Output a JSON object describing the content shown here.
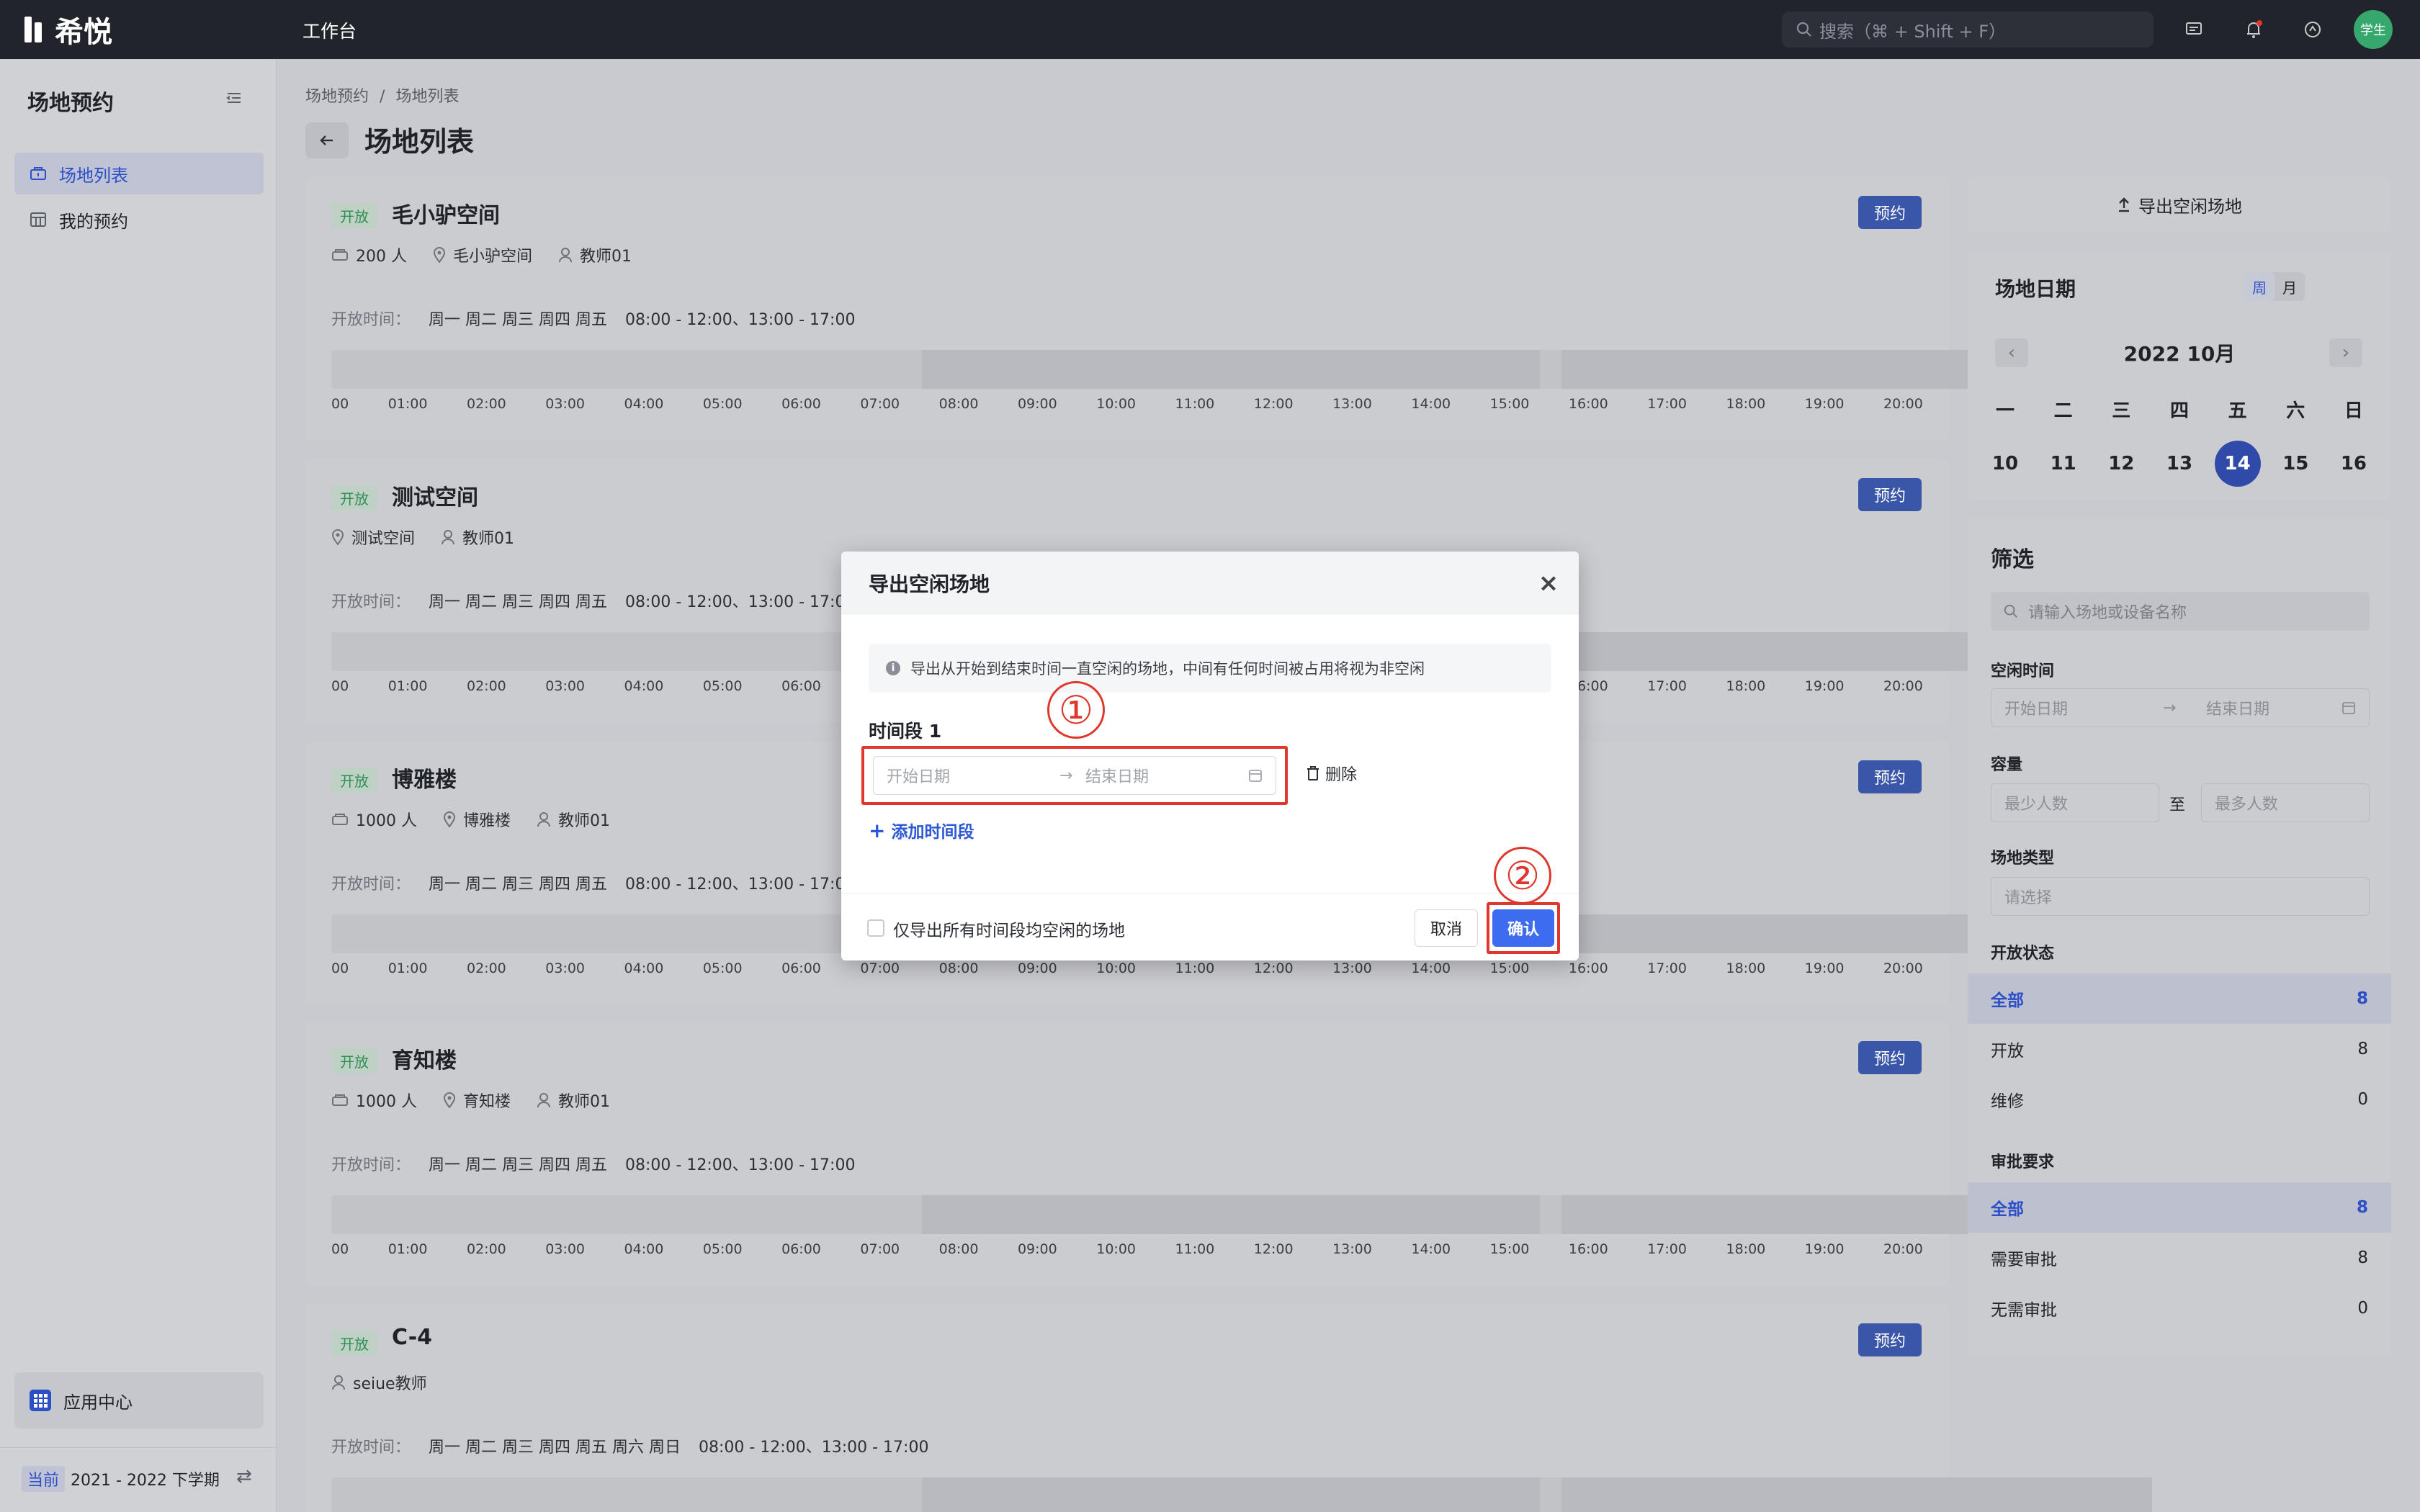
{
  "app": {
    "logo_text": "希悦",
    "nav_work": "工作台",
    "search_placeholder": "搜索（⌘ + Shift + F）",
    "avatar_text": "学生"
  },
  "sidebar": {
    "title": "场地预约",
    "items": [
      {
        "label": "场地列表",
        "icon": "venue-icon"
      },
      {
        "label": "我的预约",
        "icon": "calendar-grid-icon"
      }
    ],
    "app_center": "应用中心",
    "term_badge": "当前",
    "term_text": "2021 - 2022 下学期"
  },
  "breadcrumb": {
    "root": "场地预约",
    "sep": "/",
    "current": "场地列表"
  },
  "page_title": "场地列表",
  "hours_label": "开放时间：",
  "book_label": "预约",
  "venues": [
    {
      "tag": "开放",
      "name": "毛小驴空间",
      "capacity": "200 人",
      "location": "毛小驴空间",
      "owner": "教师01",
      "days": "周一 周二 周三 周四 周五",
      "hours": "08:00 - 12:00、13:00 - 17:00"
    },
    {
      "tag": "开放",
      "name": "测试空间",
      "capacity": "",
      "location": "测试空间",
      "owner": "教师01",
      "days": "周一 周二 周三 周四 周五",
      "hours": "08:00 - 12:00、13:00 - 17:00"
    },
    {
      "tag": "开放",
      "name": "博雅楼",
      "capacity": "1000 人",
      "location": "博雅楼",
      "owner": "教师01",
      "days": "周一 周二 周三 周四 周五",
      "hours": "08:00 - 12:00、13:00 - 17:00"
    },
    {
      "tag": "开放",
      "name": "育知楼",
      "capacity": "1000 人",
      "location": "育知楼",
      "owner": "教师01",
      "days": "周一 周二 周三 周四 周五",
      "hours": "08:00 - 12:00、13:00 - 17:00"
    },
    {
      "tag": "开放",
      "name": "C-4",
      "capacity": "",
      "location": "",
      "owner": "seiue教师",
      "days": "周一 周二 周三 周四 周五 周六 周日",
      "hours": "08:00 - 12:00、13:00 - 17:00"
    }
  ],
  "ticks": [
    "00",
    "01:00",
    "02:00",
    "03:00",
    "04:00",
    "05:00",
    "06:00",
    "07:00",
    "08:00",
    "09:00",
    "10:00",
    "11:00",
    "12:00",
    "13:00",
    "14:00",
    "15:00",
    "16:00",
    "17:00",
    "18:00",
    "19:00",
    "20:00"
  ],
  "right": {
    "export_label": "导出空闲场地",
    "calendar": {
      "title": "场地日期",
      "mode_week": "周",
      "mode_month": "月",
      "month": "2022 10月",
      "weekdays": [
        "一",
        "二",
        "三",
        "四",
        "五",
        "六",
        "日"
      ],
      "days": [
        "10",
        "11",
        "12",
        "13",
        "14",
        "15",
        "16"
      ],
      "today": "14"
    },
    "filter": {
      "title": "筛选",
      "search_placeholder": "请输入场地或设备名称",
      "free_time_label": "空闲时间",
      "start_placeholder": "开始日期",
      "end_placeholder": "结束日期",
      "capacity_label": "容量",
      "min_placeholder": "最少人数",
      "to": "至",
      "max_placeholder": "最多人数",
      "type_label": "场地类型",
      "type_placeholder": "请选择",
      "status_label": "开放状态",
      "status_options": [
        {
          "label": "全部",
          "count": "8"
        },
        {
          "label": "开放",
          "count": "8"
        },
        {
          "label": "维修",
          "count": "0"
        }
      ],
      "approval_label": "审批要求",
      "approval_options": [
        {
          "label": "全部",
          "count": "8"
        },
        {
          "label": "需要审批",
          "count": "8"
        },
        {
          "label": "无需审批",
          "count": "0"
        }
      ]
    }
  },
  "modal": {
    "title": "导出空闲场地",
    "info": "导出从开始到结束时间一直空闲的场地，中间有任何时间被占用将视为非空闲",
    "segment_label": "时间段 1",
    "start_placeholder": "开始日期",
    "end_placeholder": "结束日期",
    "delete_label": "删除",
    "add_label": "添加时间段",
    "checkbox_label": "仅导出所有时间段均空闲的场地",
    "cancel_label": "取消",
    "confirm_label": "确认",
    "annotation_1": "①",
    "annotation_2": "②"
  }
}
